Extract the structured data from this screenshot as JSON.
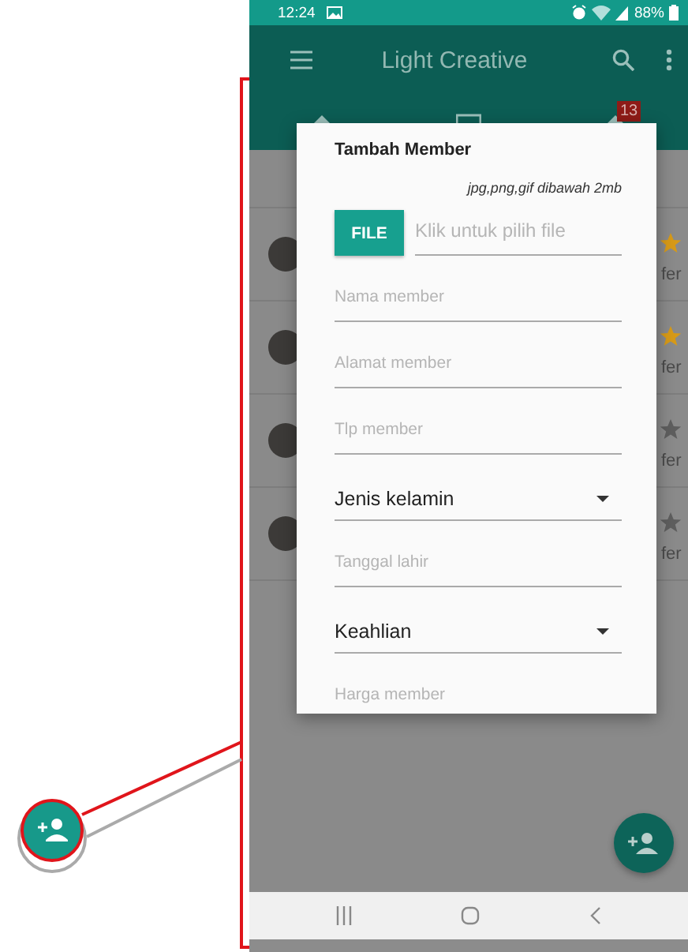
{
  "status_bar": {
    "time": "12:24",
    "battery": "88%"
  },
  "app_bar": {
    "title": "Light Creative"
  },
  "tab_badge": "13",
  "list_rows": [
    {
      "favorite": true,
      "text": "fer"
    },
    {
      "favorite": true,
      "text": "fer"
    },
    {
      "favorite": false,
      "text": "fer"
    },
    {
      "favorite": false,
      "text": "fer"
    }
  ],
  "dialog": {
    "title": "Tambah Member",
    "file_hint": "jpg,png,gif dibawah 2mb",
    "file_button": "FILE",
    "file_placeholder": "Klik untuk pilih file",
    "fields": [
      {
        "kind": "text",
        "placeholder": "Nama member"
      },
      {
        "kind": "text",
        "placeholder": "Alamat member"
      },
      {
        "kind": "text",
        "placeholder": "Tlp member"
      },
      {
        "kind": "dropdown",
        "value": "Jenis kelamin"
      },
      {
        "kind": "text",
        "placeholder": "Tanggal lahir"
      },
      {
        "kind": "dropdown",
        "value": "Keahlian"
      },
      {
        "kind": "text",
        "placeholder": "Harga member"
      }
    ]
  }
}
